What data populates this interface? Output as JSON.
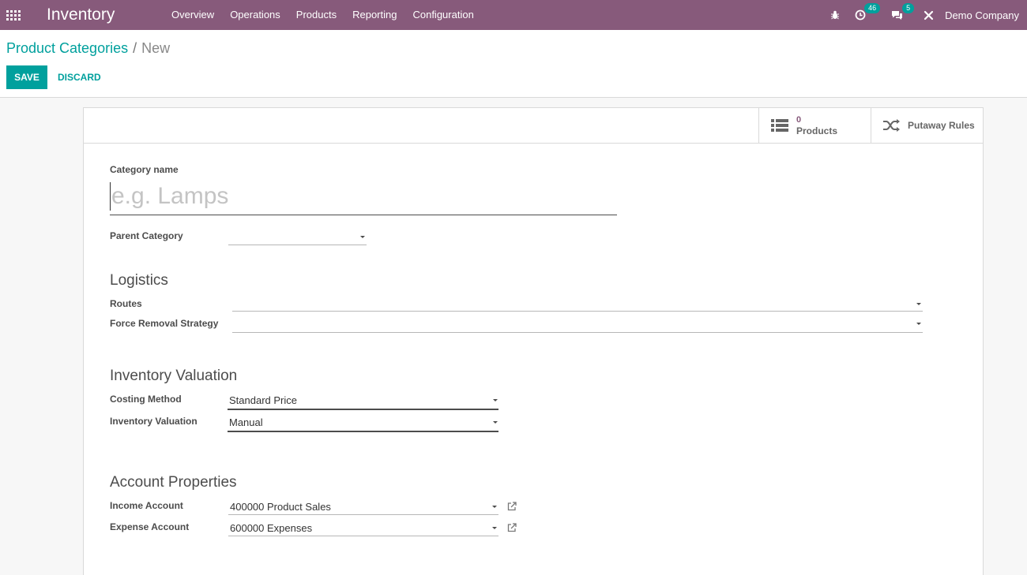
{
  "navbar": {
    "app_title": "Inventory",
    "menu": [
      "Overview",
      "Operations",
      "Products",
      "Reporting",
      "Configuration"
    ],
    "activity_count": "46",
    "messages_count": "5",
    "company": "Demo Company"
  },
  "breadcrumb": {
    "parent": "Product Categories",
    "separator": "/",
    "current": "New"
  },
  "actions": {
    "save_label": "SAVE",
    "discard_label": "DISCARD"
  },
  "stat_buttons": {
    "products_count": "0",
    "products_label": "Products",
    "putaway_label": "Putaway Rules"
  },
  "form": {
    "category_name_label": "Category name",
    "category_name_placeholder": "e.g. Lamps",
    "parent_category_label": "Parent Category",
    "logistics_title": "Logistics",
    "routes_label": "Routes",
    "removal_label": "Force Removal Strategy",
    "valuation_title": "Inventory Valuation",
    "costing_label": "Costing Method",
    "costing_value": "Standard Price",
    "valuation_label": "Inventory Valuation",
    "valuation_value": "Manual",
    "account_title": "Account Properties",
    "income_label": "Income Account",
    "income_value": "400000 Product Sales",
    "expense_label": "Expense Account",
    "expense_value": "600000 Expenses"
  },
  "colors": {
    "brand": "#875a7b",
    "accent": "#00a09d"
  }
}
